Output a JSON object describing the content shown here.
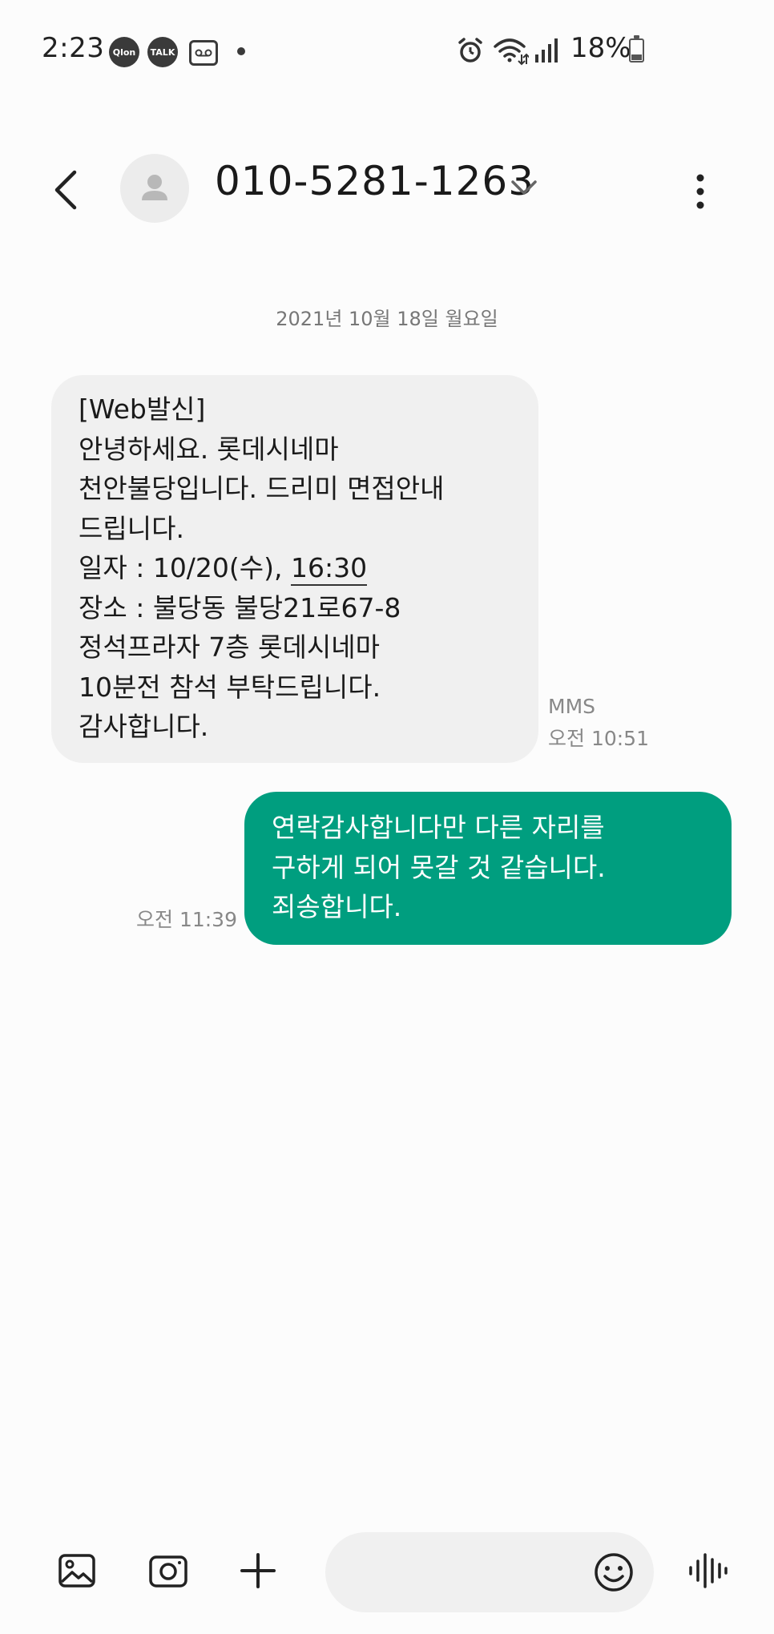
{
  "status_bar": {
    "time": "2:23",
    "notification_icons": [
      "qlon-icon",
      "kakaotalk-icon",
      "voicemail-icon"
    ],
    "battery": "18%"
  },
  "header": {
    "contact_number": "010-5281-1263"
  },
  "conversation": {
    "date_divider": "2021년 10월 18일 월요일",
    "received": {
      "lines": [
        "[Web발신]",
        "안녕하세요. 롯데시네마",
        "천안불당입니다. 드리미 면접안내",
        "드립니다.",
        "일자 : 10/20(수), ",
        "장소 : 불당동 불당21로67-8",
        "정석프라자 7층 롯데시네마",
        "10분전 참석 부탁드립니다.",
        "감사합니다."
      ],
      "time_link": "16:30",
      "type_label": "MMS",
      "timestamp": "오전 10:51"
    },
    "sent": {
      "lines": [
        "연락감사합니다만 다른 자리를",
        "구하게 되어 못갈 것 같습니다.",
        "죄송합니다."
      ],
      "timestamp": "오전 11:39"
    }
  },
  "composer": {
    "message_value": "",
    "placeholder": ""
  },
  "colors": {
    "sent_bubble": "#009e7f",
    "received_bubble": "#f0f0f0",
    "background": "#fcfcfc"
  }
}
